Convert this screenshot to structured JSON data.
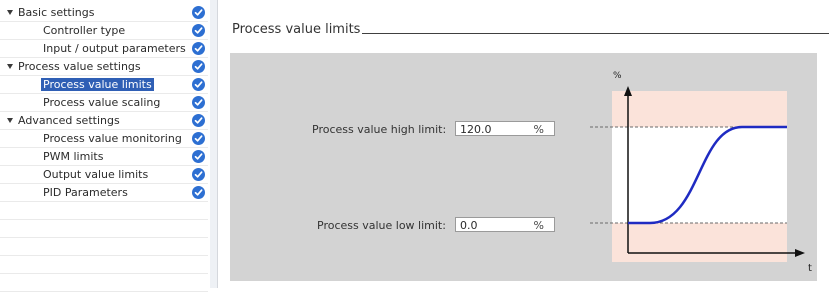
{
  "nav": {
    "items": [
      {
        "label": "Basic settings",
        "level": 0,
        "expanded": true,
        "selected": false
      },
      {
        "label": "Controller type",
        "level": 1,
        "expanded": false,
        "selected": false
      },
      {
        "label": "Input / output parameters",
        "level": 1,
        "expanded": false,
        "selected": false
      },
      {
        "label": "Process value settings",
        "level": 0,
        "expanded": true,
        "selected": false
      },
      {
        "label": "Process value limits",
        "level": 1,
        "expanded": false,
        "selected": true
      },
      {
        "label": "Process value scaling",
        "level": 1,
        "expanded": false,
        "selected": false
      },
      {
        "label": "Advanced settings",
        "level": 0,
        "expanded": true,
        "selected": false
      },
      {
        "label": "Process value monitoring",
        "level": 1,
        "expanded": false,
        "selected": false
      },
      {
        "label": "PWM limits",
        "level": 1,
        "expanded": false,
        "selected": false
      },
      {
        "label": "Output value limits",
        "level": 1,
        "expanded": false,
        "selected": false
      },
      {
        "label": "PID Parameters",
        "level": 1,
        "expanded": false,
        "selected": false
      }
    ],
    "status_icon": "check-circle-icon"
  },
  "section": {
    "title": "Process value limits"
  },
  "fields": {
    "high": {
      "label": "Process value high limit:",
      "value": "120.0",
      "unit": "%"
    },
    "low": {
      "label": "Process value low limit:",
      "value": "0.0",
      "unit": "%"
    }
  },
  "diagram": {
    "y_axis_label": "%",
    "x_axis_label": "t"
  },
  "colors": {
    "accent": "#2d6fd2",
    "selection": "#2f5fb5",
    "panel": "#d3d3d3",
    "out_of_range_band": "#fbe3da",
    "curve": "#1f2bc2"
  }
}
